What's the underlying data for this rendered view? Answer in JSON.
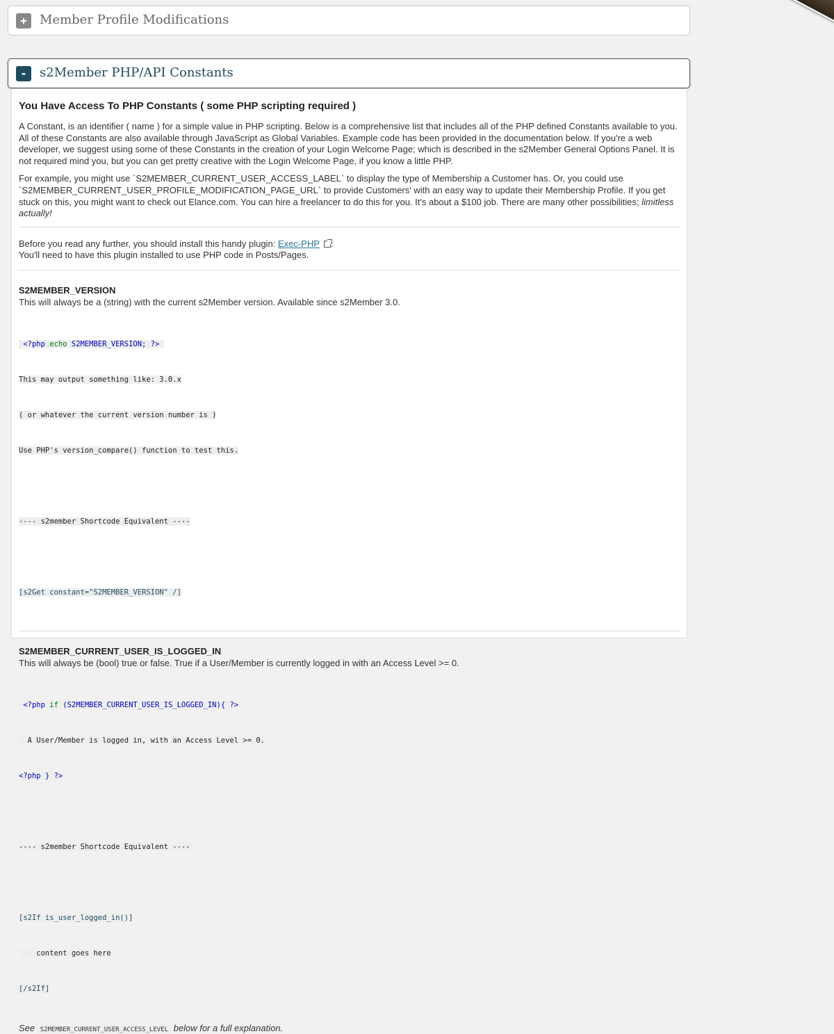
{
  "sections": {
    "profile": {
      "toggle": "+",
      "title": "Member Profile Modifications"
    },
    "constants": {
      "toggle": "-",
      "title": "s2Member PHP/API Constants"
    }
  },
  "panel": {
    "heading": "You Have Access To PHP Constants ( some PHP scripting required )",
    "intro": "A Constant, is an identifier ( name ) for a simple value in PHP scripting. Below is a comprehensive list that includes all of the PHP defined Constants available to you. All of these Constants are also available through JavaScript as Global Variables. Example code has been provided in the documentation below. If you're a web developer, we suggest using some of these Constants in the creation of your Login Welcome Page; which is described in the s2Member General Options Panel. It is not required mind you, but you can get pretty creative with the Login Welcome Page, if you know a little PHP.",
    "example_text": "For example, you might use `S2MEMBER_CURRENT_USER_ACCESS_LABEL` to display the type of Membership a Customer has. Or, you could use `S2MEMBER_CURRENT_USER_PROFILE_MODIFICATION_PAGE_URL` to provide Customers' with an easy way to update their Membership Profile. If you get stuck on this, you might want to check out Elance.com. You can hire a freelancer to do this for you. It's about a $100 job. There are many other possibilities;",
    "example_italic": "limitless actually!",
    "plugin_before": "Before you read any further, you should install this handy plugin:",
    "plugin_link": "Exec-PHP",
    "plugin_after": ".",
    "plugin_note": "You'll need to have this plugin installed to use PHP code in Posts/Pages."
  },
  "constants": [
    {
      "name": "S2MEMBER_VERSION",
      "desc": "This will always be a (string) with the current s2Member version. Available since s2Member 3.0.",
      "code": {
        "php_open": "<?php",
        "echo": "echo",
        "const": "S2MEMBER_VERSION;",
        "php_close": "?>",
        "out1": "This may output something like: 3.0.x",
        "out2": "( or whatever the current version number is )",
        "out3": "Use PHP's version_compare() function to test this.",
        "shortcode_heading": "---- s2member Shortcode Equivalent ----",
        "shortcode": "[s2Get constant=\"S2MEMBER_VERSION\" /]"
      }
    },
    {
      "name": "S2MEMBER_CURRENT_USER_IS_LOGGED_IN",
      "desc": "This will always be (bool) true or false. True if a User/Member is currently logged in with an Access Level >= 0.",
      "code": {
        "php_open": "<?php",
        "if_kw": "if",
        "cond": "(S2MEMBER_CURRENT_USER_IS_LOGGED_IN){",
        "php_close": "?>",
        "body": "  A User/Member is logged in, with an Access Level >= 0.",
        "end_open": "<?php",
        "end_brace": "}",
        "end_close": "?>",
        "shortcode_heading": "---- s2member Shortcode Equivalent ----",
        "sc_open": "[s2If is_user_logged_in()]",
        "sc_body": "    content goes here",
        "sc_close": "[/s2If]"
      },
      "see_before": "See",
      "see_code": "S2MEMBER_CURRENT_USER_ACCESS_LEVEL",
      "see_after": "below for a full explanation."
    }
  ]
}
